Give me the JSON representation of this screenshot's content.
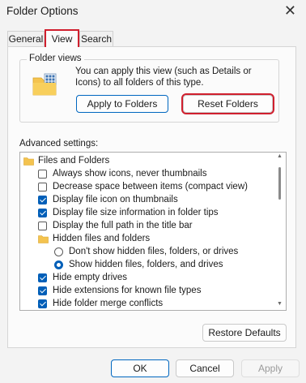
{
  "window": {
    "title": "Folder Options",
    "close_glyph": "✕"
  },
  "tabs": [
    {
      "label": "General",
      "active": false
    },
    {
      "label": "View",
      "active": true
    },
    {
      "label": "Search",
      "active": false
    }
  ],
  "folder_views": {
    "title": "Folder views",
    "description": "You can apply this view (such as Details or Icons) to all folders of this type.",
    "apply_label": "Apply to Folders",
    "reset_label": "Reset Folders",
    "icon": "folder-grid-icon"
  },
  "advanced": {
    "label": "Advanced settings:",
    "items": [
      {
        "type": "folder",
        "label": "Files and Folders"
      },
      {
        "type": "checkbox",
        "label": "Always show icons, never thumbnails",
        "checked": false
      },
      {
        "type": "checkbox",
        "label": "Decrease space between items (compact view)",
        "checked": false
      },
      {
        "type": "checkbox",
        "label": "Display file icon on thumbnails",
        "checked": true
      },
      {
        "type": "checkbox",
        "label": "Display file size information in folder tips",
        "checked": true
      },
      {
        "type": "checkbox",
        "label": "Display the full path in the title bar",
        "checked": false
      },
      {
        "type": "folder",
        "label": "Hidden files and folders"
      },
      {
        "type": "radio",
        "label": "Don't show hidden files, folders, or drives",
        "checked": false
      },
      {
        "type": "radio",
        "label": "Show hidden files, folders, and drives",
        "checked": true
      },
      {
        "type": "checkbox",
        "label": "Hide empty drives",
        "checked": true
      },
      {
        "type": "checkbox",
        "label": "Hide extensions for known file types",
        "checked": true
      },
      {
        "type": "checkbox",
        "label": "Hide folder merge conflicts",
        "checked": true
      }
    ]
  },
  "restore_label": "Restore Defaults",
  "footer": {
    "ok_label": "OK",
    "cancel_label": "Cancel",
    "apply_label": "Apply"
  },
  "colors": {
    "highlight": "#d01f2e",
    "accent": "#005fb8",
    "folder": "#f4c34f"
  }
}
